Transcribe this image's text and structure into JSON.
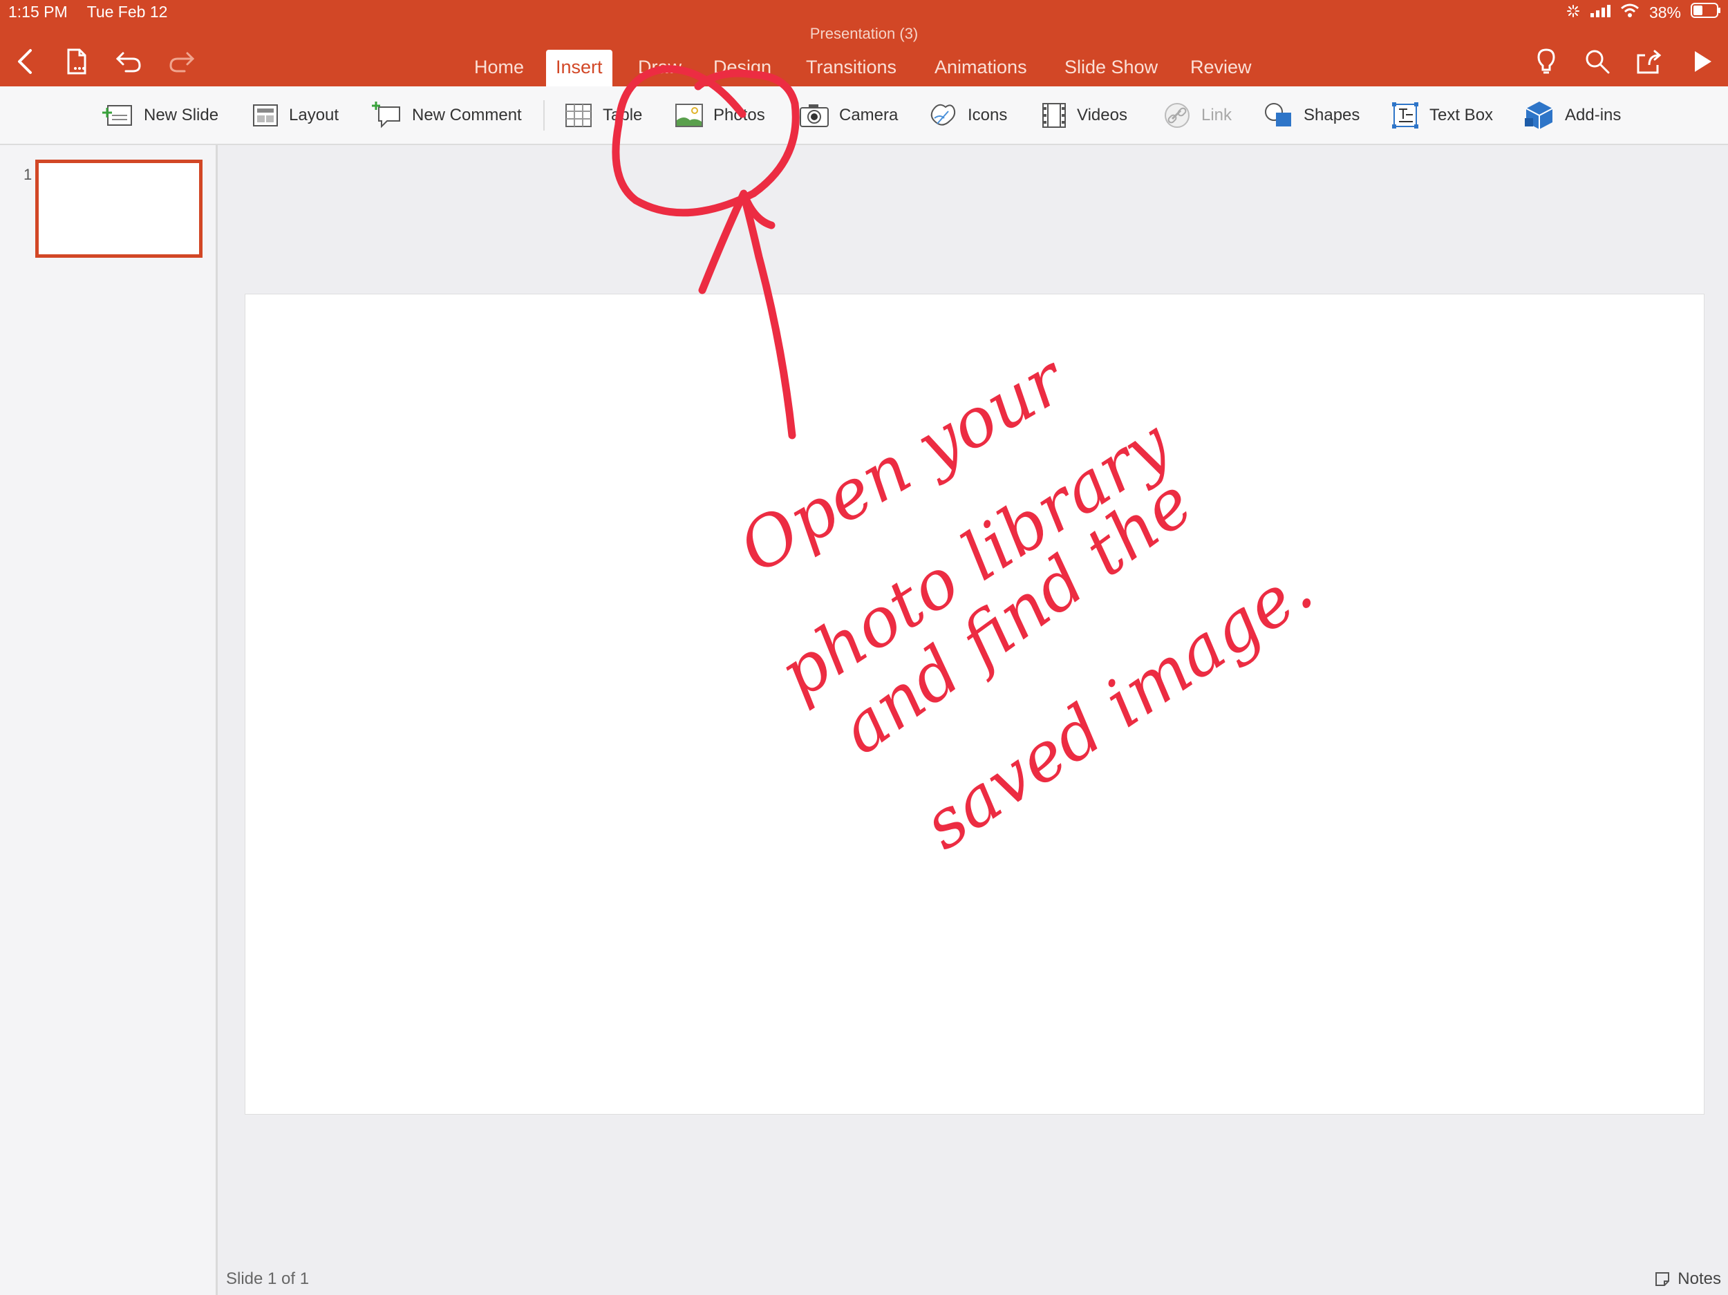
{
  "status_bar": {
    "time": "1:15 PM",
    "date": "Tue Feb 12",
    "battery": "38%"
  },
  "document": {
    "title": "Presentation (3)"
  },
  "tabs": [
    {
      "label": "Home"
    },
    {
      "label": "Insert",
      "active": true
    },
    {
      "label": "Draw"
    },
    {
      "label": "Design"
    },
    {
      "label": "Transitions"
    },
    {
      "label": "Animations"
    },
    {
      "label": "Slide Show"
    },
    {
      "label": "Review"
    }
  ],
  "ribbon": {
    "new_slide": "New Slide",
    "layout": "Layout",
    "new_comment": "New Comment",
    "table": "Table",
    "photos": "Photos",
    "camera": "Camera",
    "icons": "Icons",
    "videos": "Videos",
    "link": "Link",
    "shapes": "Shapes",
    "text_box": "Text Box",
    "add_ins": "Add-ins"
  },
  "thumbnails": [
    {
      "number": "1"
    }
  ],
  "footer": {
    "slide_indicator": "Slide 1 of 1",
    "notes": "Notes"
  },
  "annotation": {
    "lines": [
      "Open your",
      "photo library",
      "and find the",
      "saved image."
    ],
    "color": "#ec2c42"
  },
  "colors": {
    "accent": "#d24726",
    "ink": "#ec2c42"
  }
}
